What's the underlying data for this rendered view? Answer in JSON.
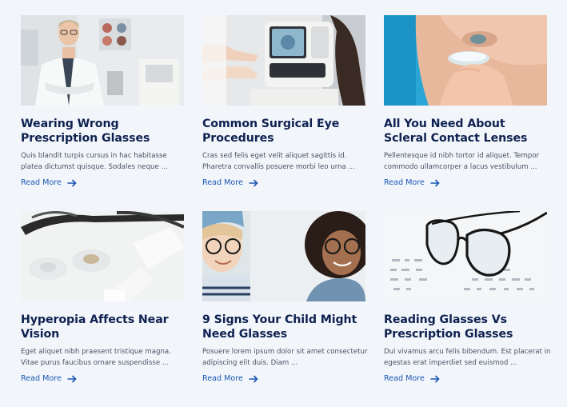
{
  "posts": [
    {
      "title": "Wearing Wrong Prescription Glasses",
      "excerpt": "Quis blandit turpis cursus in hac habitasse platea dictumst quisque. Sodales neque ...",
      "link_label": "Read More",
      "image_icon": "optometrist-photo"
    },
    {
      "title": "Common Surgical Eye Procedures",
      "excerpt": "Cras sed felis eget velit aliquet sagittis id. Pharetra convallis posuere morbi leo urna ...",
      "link_label": "Read More",
      "image_icon": "eye-exam-machine-photo"
    },
    {
      "title": "All You Need About Scleral Contact Lenses",
      "excerpt": "Pellentesque id nibh tortor id aliquet. Tempor commodo ullamcorper a lacus vestibulum ...",
      "link_label": "Read More",
      "image_icon": "contact-lens-photo"
    },
    {
      "title": "Hyperopia Affects Near Vision",
      "excerpt": "Eget aliquet nibh praesent tristique magna. Vitae purus faucibus ornare suspendisse ...",
      "link_label": "Read More",
      "image_icon": "lens-case-photo"
    },
    {
      "title": "9 Signs Your Child Might Need Glasses",
      "excerpt": "Posuere lorem ipsum dolor sit amet consectetur adipiscing elit duis. Diam ...",
      "link_label": "Read More",
      "image_icon": "children-glasses-photo"
    },
    {
      "title": "Reading Glasses Vs Prescription Glasses",
      "excerpt": "Dui vivamus arcu felis bibendum. Est placerat in egestas erat imperdiet sed euismod ...",
      "link_label": "Read More",
      "image_icon": "glasses-on-chart-photo"
    }
  ],
  "colors": {
    "background": "#f2f6fb",
    "title": "#0e2150",
    "excerpt": "#4a5163",
    "link": "#1b57b5"
  }
}
